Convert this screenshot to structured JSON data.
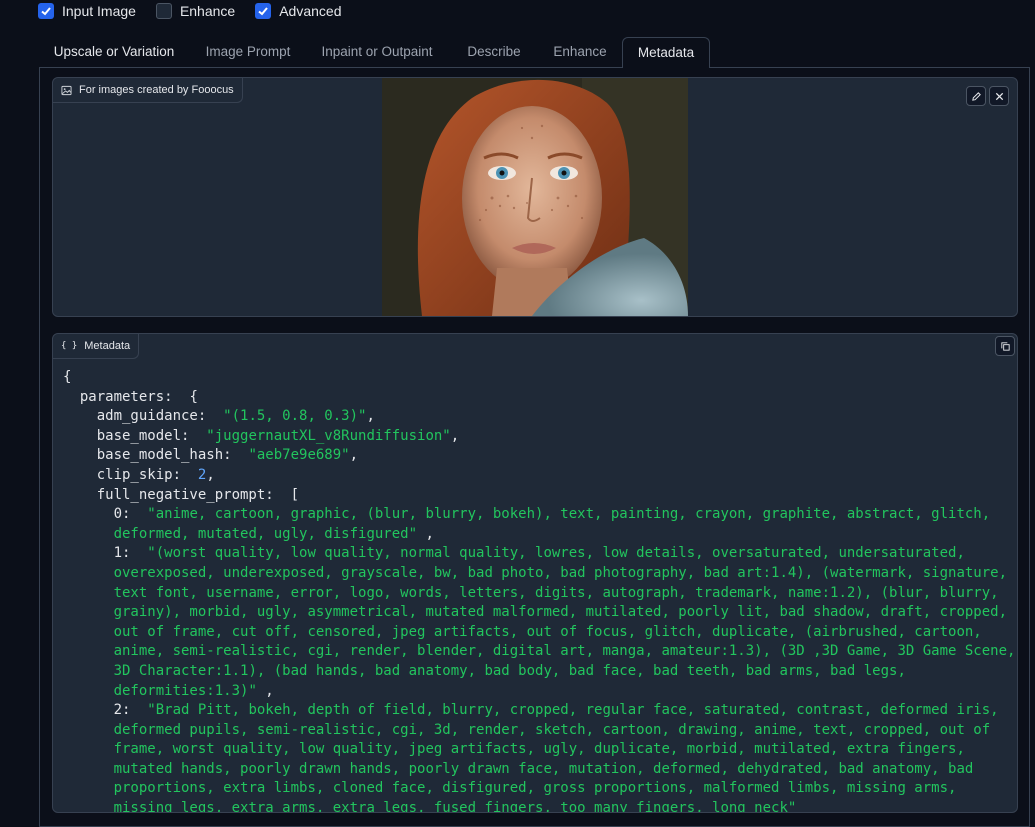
{
  "checkboxes": [
    {
      "label": "Input Image",
      "checked": true
    },
    {
      "label": "Enhance",
      "checked": false
    },
    {
      "label": "Advanced",
      "checked": true
    }
  ],
  "tabs": [
    {
      "label": "Upscale or Variation"
    },
    {
      "label": "Image Prompt"
    },
    {
      "label": "Inpaint or Outpaint"
    },
    {
      "label": "Describe"
    },
    {
      "label": "Enhance"
    },
    {
      "label": "Metadata",
      "active": true
    }
  ],
  "image_panel": {
    "label": "For images created by Fooocus",
    "label_icon": "image-icon",
    "edit_icon": "pencil-icon",
    "close_icon": "close-icon"
  },
  "metadata_panel": {
    "label": "Metadata",
    "label_icon": "json-braces-icon",
    "copy_icon": "copy-icon",
    "lines": {
      "l0": "{",
      "l1a": "parameters:",
      "l1b": "{",
      "adm_key": "adm_guidance:",
      "adm_val": "\"(1.5, 0.8, 0.3)\"",
      "bm_key": "base_model:",
      "bm_val": "\"juggernautXL_v8Rundiffusion\"",
      "bmh_key": "base_model_hash:",
      "bmh_val": "\"aeb7e9e689\"",
      "cs_key": "clip_skip:",
      "cs_val": "2",
      "fnp_key": "full_negative_prompt:",
      "fnp_open": "[",
      "i0": "0:",
      "i0_l1": "\"anime, cartoon, graphic, (blur, blurry, bokeh), text, painting, crayon, graphite, abstract, glitch,",
      "i0_l2": "deformed, mutated, ugly, disfigured\"",
      "i1": "1:",
      "i1_l1": "\"(worst quality, low quality, normal quality, lowres, low details, oversaturated, undersaturated,",
      "i1_l2": "overexposed, underexposed, grayscale, bw, bad photo, bad photography, bad art:1.4), (watermark, signature,",
      "i1_l3": "text font, username, error, logo, words, letters, digits, autograph, trademark, name:1.2), (blur, blurry,",
      "i1_l4": "grainy), morbid, ugly, asymmetrical, mutated malformed, mutilated, poorly lit, bad shadow, draft, cropped,",
      "i1_l5": "out of frame, cut off, censored, jpeg artifacts, out of focus, glitch, duplicate, (airbrushed, cartoon,",
      "i1_l6": "anime, semi-realistic, cgi, render, blender, digital art, manga, amateur:1.3), (3D ,3D Game, 3D Game Scene,",
      "i1_l7": "3D Character:1.1), (bad hands, bad anatomy, bad body, bad face, bad teeth, bad arms, bad legs,",
      "i1_l8": "deformities:1.3)\"",
      "i2": "2:",
      "i2_l1": "\"Brad Pitt, bokeh, depth of field, blurry, cropped, regular face, saturated, contrast, deformed iris,",
      "i2_l2": "deformed pupils, semi-realistic, cgi, 3d, render, sketch, cartoon, drawing, anime, text, cropped, out of",
      "i2_l3": "frame, worst quality, low quality, jpeg artifacts, ugly, duplicate, morbid, mutilated, extra fingers,",
      "i2_l4": "mutated hands, poorly drawn hands, poorly drawn face, mutation, deformed, dehydrated, bad anatomy, bad",
      "i2_l5": "proportions, extra limbs, cloned face, disfigured, gross proportions, malformed limbs, missing arms,",
      "i2_l6": "missing legs, extra arms, extra legs, fused fingers, too many fingers, long neck\""
    }
  },
  "colors": {
    "background": "#0b0f19",
    "panel": "#1f2937",
    "border": "#374151",
    "accent": "#2563eb",
    "string": "#22c55e",
    "number": "#60a5fa"
  }
}
